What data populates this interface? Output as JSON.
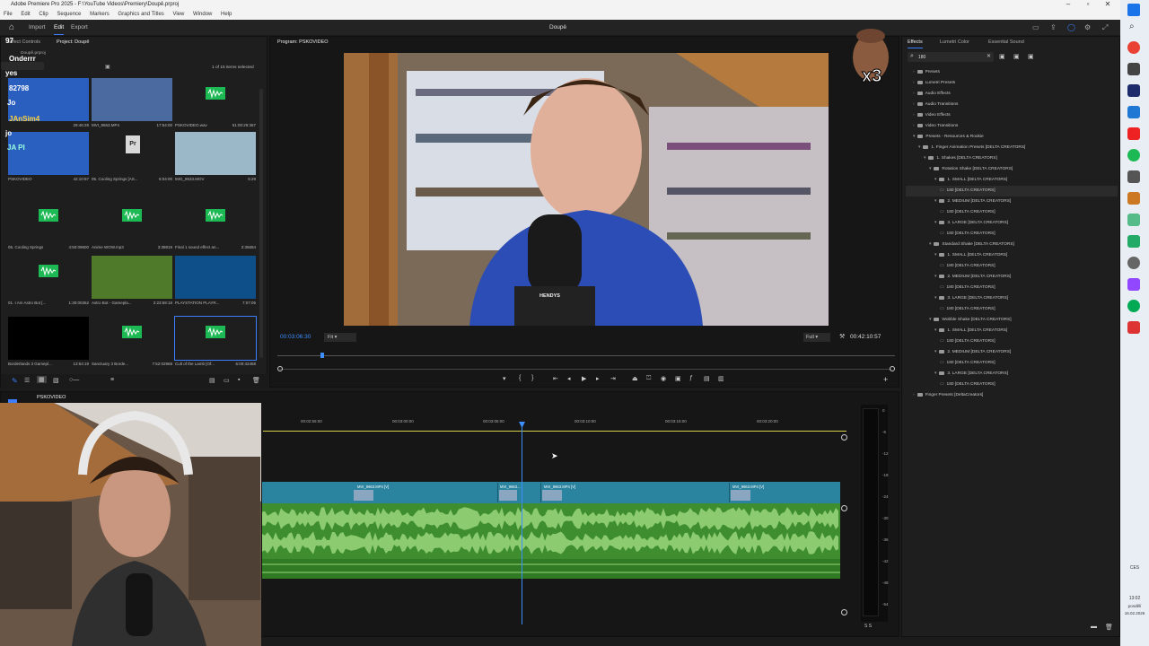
{
  "titlebar": {
    "title": "Adobe Premiere Pro 2025 - F:\\YouTube Videos\\Premiery\\Doupě.prproj"
  },
  "menu": [
    "File",
    "Edit",
    "Clip",
    "Sequence",
    "Markers",
    "Graphics and Titles",
    "View",
    "Window",
    "Help"
  ],
  "app": {
    "tabs": [
      "Import",
      "Edit",
      "Export"
    ],
    "active_tab": "Edit",
    "project_name": "Doupě"
  },
  "project_panel": {
    "tabs": [
      "Effect Controls",
      "Project: Doupě"
    ],
    "file": "Doupě.prproj",
    "items_selected": "1 of 15 items selected",
    "items": [
      {
        "name": "",
        "duration": "29:46:28",
        "kind": "video"
      },
      {
        "name": "MVI_9663.MP4",
        "duration": "17:54:00",
        "kind": "video"
      },
      {
        "name": "PSKOVIDEO.wav",
        "duration": "51:00:29:367",
        "kind": "audio"
      },
      {
        "name": "PSKOVIDEO",
        "duration": "42:10:57",
        "kind": "video"
      },
      {
        "name": "05. Cooling Springs [AS...",
        "duration": "6:04:00",
        "kind": "project"
      },
      {
        "name": "IMG_8533.MOV",
        "duration": "5:29",
        "kind": "video"
      },
      {
        "name": "05. Cooling Springs",
        "duration": "4:50:09600",
        "kind": "audio"
      },
      {
        "name": "Anime WOW.mp3",
        "duration": "3:38819",
        "kind": "audio"
      },
      {
        "name": "Final 1 sound effect an...",
        "duration": "2:35684",
        "kind": "audio"
      },
      {
        "name": "01. I Am Astro Bot [...",
        "duration": "1:30:00362",
        "kind": "audio"
      },
      {
        "name": "Astro Bot - Gamepla...",
        "duration": "2:23:59:18",
        "kind": "video"
      },
      {
        "name": "PLAYSTATION PLAYR...",
        "duration": "7:07:05",
        "kind": "video"
      },
      {
        "name": "Borderlands 3 Gamepl...",
        "duration": "13:54:19",
        "kind": "video"
      },
      {
        "name": "Sanctuary 3 Borde...",
        "duration": "7:52:02968",
        "kind": "audio"
      },
      {
        "name": "Cult of the Lamb [Of...",
        "duration": "6:00:42458",
        "kind": "audio"
      }
    ]
  },
  "chat_overlay": [
    "97",
    "Onderrr",
    "yes",
    "82798",
    "Jo",
    "JAnSim4",
    "jo",
    "JA PI"
  ],
  "program_monitor": {
    "title": "Program: PSKOVIDEO",
    "timecode": "00:03:06:30",
    "fit": "Fit",
    "quality": "Full",
    "duration": "00:42:10:57",
    "camera_text": "HENDYS"
  },
  "sticker": {
    "text": "x3"
  },
  "effects_panel": {
    "tabs": [
      "Effects",
      "Lumetri Color",
      "Essential Sound"
    ],
    "search_value": "180",
    "tree": [
      {
        "label": "Presets",
        "level": 0,
        "open": false
      },
      {
        "label": "Lumetri Presets",
        "level": 0,
        "open": false
      },
      {
        "label": "Audio Effects",
        "level": 0,
        "open": false
      },
      {
        "label": "Audio Transitions",
        "level": 0,
        "open": false
      },
      {
        "label": "Video Effects",
        "level": 0,
        "open": false
      },
      {
        "label": "Video Transitions",
        "level": 0,
        "open": false
      },
      {
        "label": "Presets - Resources & Rookie",
        "level": 0,
        "open": true
      },
      {
        "label": "1. Finger Animation Presets [DELTA CREATORS]",
        "level": 1,
        "open": true
      },
      {
        "label": "1. Shakes [DELTA CREATORS]",
        "level": 2,
        "open": true
      },
      {
        "label": "Rotation Shake [DELTA CREATORS]",
        "level": 3,
        "open": true
      },
      {
        "label": "1. SMALL [DELTA CREATORS]",
        "level": 4,
        "open": true
      },
      {
        "label": "180 [DELTA CREATORS]",
        "level": 5,
        "leaf": true,
        "selected": true
      },
      {
        "label": "2. MEDIUM [DELTA CREATORS]",
        "level": 4,
        "open": true
      },
      {
        "label": "180 [DELTA CREATORS]",
        "level": 5,
        "leaf": true
      },
      {
        "label": "3. LARGE [DELTA CREATORS]",
        "level": 4,
        "open": true
      },
      {
        "label": "180 [DELTA CREATORS]",
        "level": 5,
        "leaf": true
      },
      {
        "label": "Standard Shake [DELTA CREATORS]",
        "level": 3,
        "open": true
      },
      {
        "label": "1. SMALL [DELTA CREATORS]",
        "level": 4,
        "open": true
      },
      {
        "label": "180 [DELTA CREATORS]",
        "level": 5,
        "leaf": true
      },
      {
        "label": "2. MEDIUM [DELTA CREATORS]",
        "level": 4,
        "open": true
      },
      {
        "label": "180 [DELTA CREATORS]",
        "level": 5,
        "leaf": true
      },
      {
        "label": "3. LARGE [DELTA CREATORS]",
        "level": 4,
        "open": true
      },
      {
        "label": "180 [DELTA CREATORS]",
        "level": 5,
        "leaf": true
      },
      {
        "label": "Wobble Shake [DELTA CREATORS]",
        "level": 3,
        "open": true
      },
      {
        "label": "1. SMALL [DELTA CREATORS]",
        "level": 4,
        "open": true
      },
      {
        "label": "180 [DELTA CREATORS]",
        "level": 5,
        "leaf": true
      },
      {
        "label": "2. MEDIUM [DELTA CREATORS]",
        "level": 4,
        "open": true
      },
      {
        "label": "180 [DELTA CREATORS]",
        "level": 5,
        "leaf": true
      },
      {
        "label": "3. LARGE [DELTA CREATORS]",
        "level": 4,
        "open": true
      },
      {
        "label": "180 [DELTA CREATORS]",
        "level": 5,
        "leaf": true
      },
      {
        "label": "Finger Presets [DeltaCreators]",
        "level": 0,
        "open": false
      }
    ]
  },
  "timeline": {
    "sequence": "PSKOVIDEO",
    "ticks": [
      "00:02:55:00",
      "00:03:00:00",
      "00:03:05:00",
      "00:03:10:00",
      "00:03:15:00",
      "00:03:20:00"
    ],
    "clips": [
      {
        "label": "MVI_9663.MP4 [V]"
      },
      {
        "label": "MVI_9663..."
      },
      {
        "label": "MVI_9663.MP4 [V]"
      },
      {
        "label": "MVI_9663.MP4 [V]"
      }
    ],
    "meter_scale": [
      "0",
      "-6",
      "-12",
      "-18",
      "-24",
      "-30",
      "-36",
      "-42",
      "-48",
      "-54"
    ]
  },
  "system": {
    "lang": "CES",
    "time": "13:02",
    "day": "pondělí",
    "date": "16.02.2026"
  }
}
